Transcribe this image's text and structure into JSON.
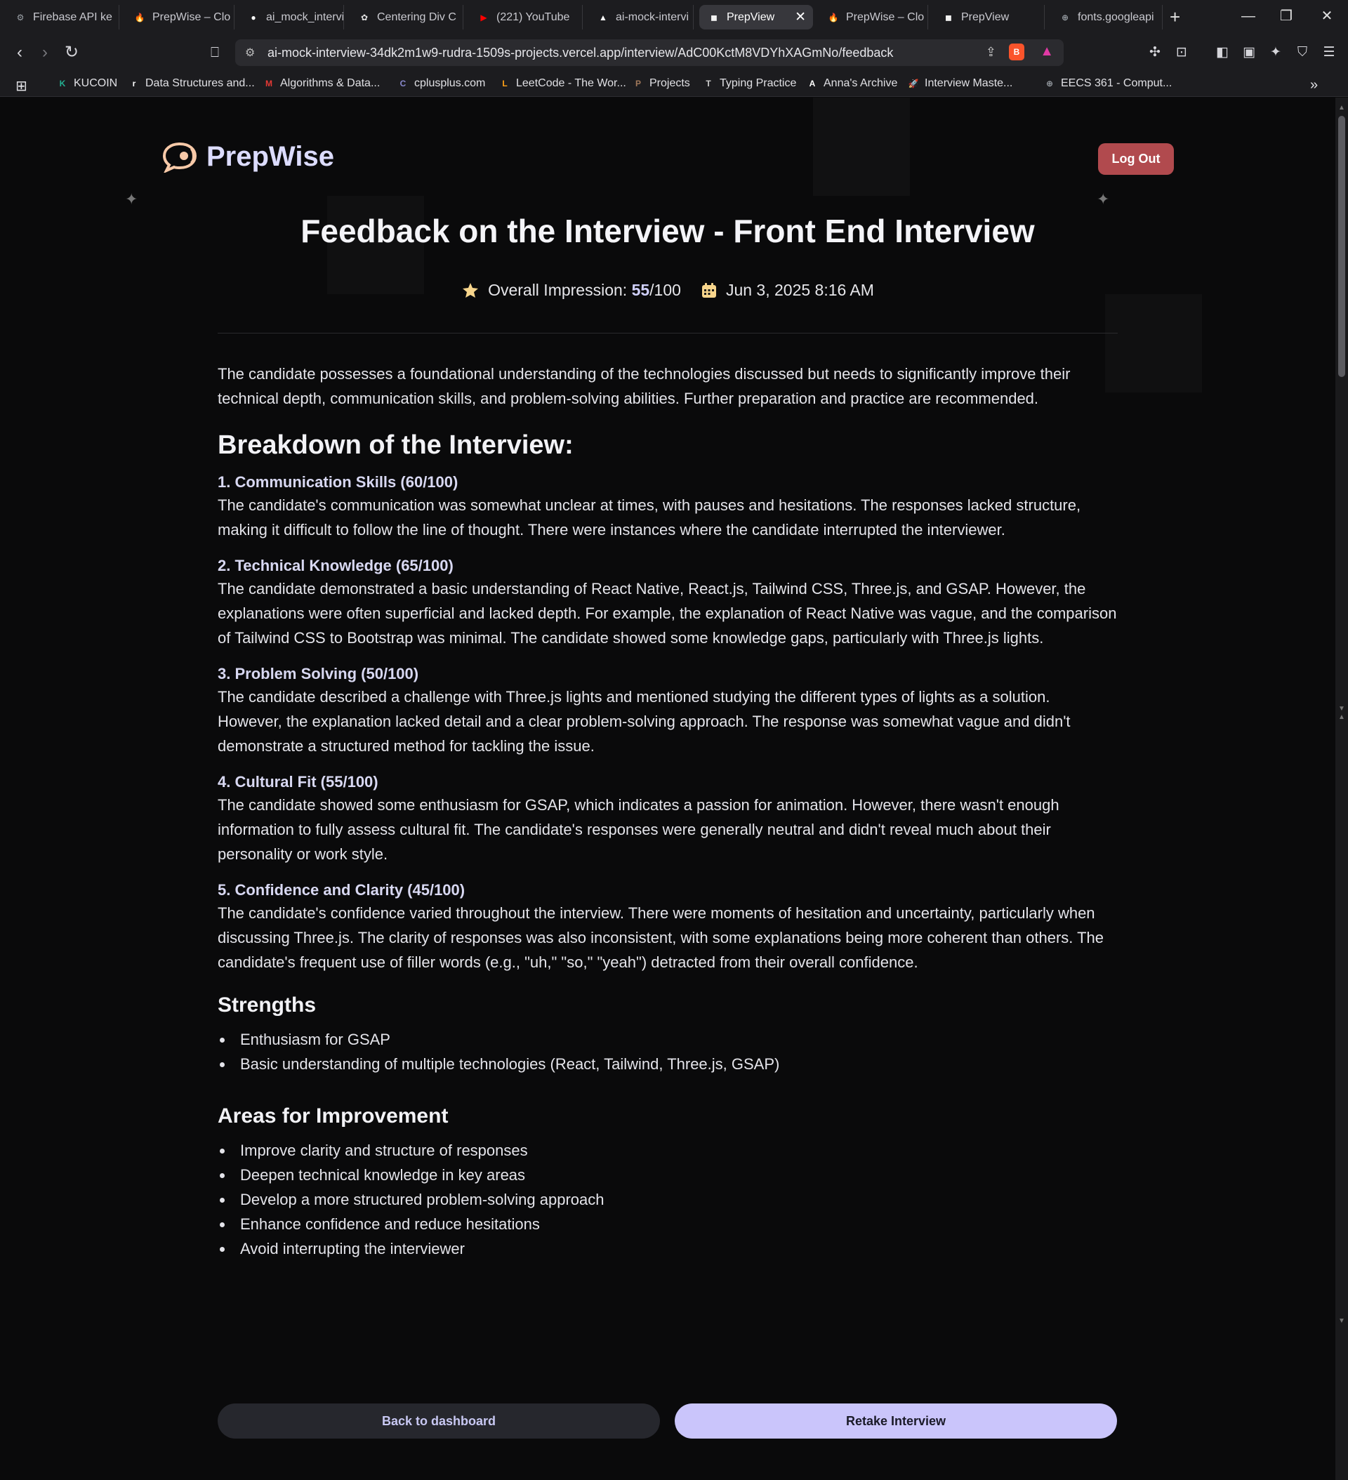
{
  "browser": {
    "tabs": [
      {
        "label": "Firebase API ke",
        "icon": "firebase-api-icon",
        "color": "#9aa0a6",
        "glyph": "⚙"
      },
      {
        "label": "PrepWise – Clo",
        "icon": "firebase-icon",
        "color": "#f57c00",
        "glyph": "🔥"
      },
      {
        "label": "ai_mock_intervi",
        "icon": "github-icon",
        "color": "#ffffff",
        "glyph": "●"
      },
      {
        "label": "Centering Div C",
        "icon": "chatgpt-icon",
        "color": "#e0e0e0",
        "glyph": "✿"
      },
      {
        "label": "(221) YouTube",
        "icon": "youtube-icon",
        "color": "#ff0000",
        "glyph": "▶"
      },
      {
        "label": "ai-mock-intervi",
        "icon": "vercel-icon",
        "color": "#ffffff",
        "glyph": "▲"
      },
      {
        "label": "PrepView",
        "icon": "prepview-icon",
        "color": "#f2f2f2",
        "glyph": "◼",
        "active": true
      },
      {
        "label": "PrepWise – Clo",
        "icon": "firebase-icon",
        "color": "#f57c00",
        "glyph": "🔥"
      },
      {
        "label": "PrepView",
        "icon": "prepview-icon",
        "color": "#f2f2f2",
        "glyph": "◼"
      },
      {
        "label": "fonts.googleapi",
        "icon": "globe-icon",
        "color": "#9aa0a6",
        "glyph": "⊕"
      }
    ],
    "url": "ai-mock-interview-34dk2m1w9-rudra-1509s-projects.vercel.app/interview/AdC00KctM8VDYhXAGmNo/feedback",
    "bookmarks": [
      {
        "label": "KUCOIN",
        "icon": "kucoin-icon",
        "color": "#23af91",
        "glyph": "K"
      },
      {
        "label": "Data Structures and...",
        "icon": "bookmark-icon",
        "color": "#ffffff",
        "glyph": "r"
      },
      {
        "label": "Algorithms & Data...",
        "icon": "bookmark-icon",
        "color": "#e53935",
        "glyph": "M"
      },
      {
        "label": "cplusplus.com",
        "icon": "cplusplus-icon",
        "color": "#8888cc",
        "glyph": "C"
      },
      {
        "label": "LeetCode - The Wor...",
        "icon": "leetcode-icon",
        "color": "#ffa116",
        "glyph": "L"
      },
      {
        "label": "Projects",
        "icon": "projects-icon",
        "color": "#a0785a",
        "glyph": "P"
      },
      {
        "label": "Typing Practice",
        "icon": "typing-icon",
        "color": "#cccccc",
        "glyph": "T"
      },
      {
        "label": "Anna's Archive",
        "icon": "annas-archive-icon",
        "color": "#ffffff",
        "glyph": "A"
      },
      {
        "label": "Interview Maste...",
        "icon": "rocket-icon",
        "color": "#e91e63",
        "glyph": "🚀"
      },
      {
        "label": "EECS 361 - Comput...",
        "icon": "globe-icon",
        "color": "#9aa0a6",
        "glyph": "⊕"
      }
    ]
  },
  "app": {
    "brand": "PrepWise",
    "logout_label": "Log Out"
  },
  "feedback": {
    "title": "Feedback on the Interview - Front End Interview",
    "impression_label": "Overall Impression: ",
    "score": "55",
    "score_suffix": "/100",
    "date": "Jun 3, 2025 8:16 AM",
    "summary": "The candidate possesses a foundational understanding of the technologies discussed but needs to significantly improve their technical depth, communication skills, and problem-solving abilities. Further preparation and practice are recommended.",
    "breakdown_heading": "Breakdown of the Interview:",
    "categories": [
      {
        "title": "1. Communication Skills (60/100)",
        "text": "The candidate's communication was somewhat unclear at times, with pauses and hesitations. The responses lacked structure, making it difficult to follow the line of thought. There were instances where the candidate interrupted the interviewer."
      },
      {
        "title": "2. Technical Knowledge (65/100)",
        "text": "The candidate demonstrated a basic understanding of React Native, React.js, Tailwind CSS, Three.js, and GSAP. However, the explanations were often superficial and lacked depth. For example, the explanation of React Native was vague, and the comparison of Tailwind CSS to Bootstrap was minimal. The candidate showed some knowledge gaps, particularly with Three.js lights."
      },
      {
        "title": "3. Problem Solving (50/100)",
        "text": "The candidate described a challenge with Three.js lights and mentioned studying the different types of lights as a solution. However, the explanation lacked detail and a clear problem-solving approach. The response was somewhat vague and didn't demonstrate a structured method for tackling the issue."
      },
      {
        "title": "4. Cultural Fit (55/100)",
        "text": "The candidate showed some enthusiasm for GSAP, which indicates a passion for animation. However, there wasn't enough information to fully assess cultural fit. The candidate's responses were generally neutral and didn't reveal much about their personality or work style."
      },
      {
        "title": "5. Confidence and Clarity (45/100)",
        "text": "The candidate's confidence varied throughout the interview. There were moments of hesitation and uncertainty, particularly when discussing Three.js. The clarity of responses was also inconsistent, with some explanations being more coherent than others. The candidate's frequent use of filler words (e.g., \"uh,\" \"so,\" \"yeah\") detracted from their overall confidence."
      }
    ],
    "strengths_heading": "Strengths",
    "strengths": [
      "Enthusiasm for GSAP",
      "Basic understanding of multiple technologies (React, Tailwind, Three.js, GSAP)"
    ],
    "improvement_heading": "Areas for Improvement",
    "improvements": [
      "Improve clarity and structure of responses",
      "Deepen technical knowledge in key areas",
      "Develop a more structured problem-solving approach",
      "Enhance confidence and reduce hesitations",
      "Avoid interrupting the interviewer"
    ],
    "back_label": "Back to dashboard",
    "retake_label": "Retake Interview"
  }
}
